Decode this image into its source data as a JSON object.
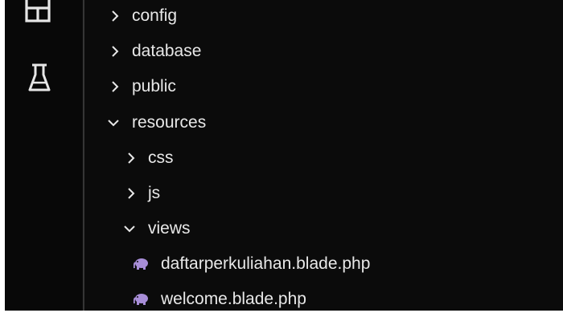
{
  "activity_bar": {
    "icons": [
      "extensions-icon",
      "testing-flask-icon"
    ]
  },
  "explorer": {
    "items": [
      {
        "label": "config",
        "type": "folder",
        "expanded": false,
        "depth": 0
      },
      {
        "label": "database",
        "type": "folder",
        "expanded": false,
        "depth": 0
      },
      {
        "label": "public",
        "type": "folder",
        "expanded": false,
        "depth": 0
      },
      {
        "label": "resources",
        "type": "folder",
        "expanded": true,
        "depth": 0
      },
      {
        "label": "css",
        "type": "folder",
        "expanded": false,
        "depth": 1
      },
      {
        "label": "js",
        "type": "folder",
        "expanded": false,
        "depth": 1
      },
      {
        "label": "views",
        "type": "folder",
        "expanded": true,
        "depth": 1
      },
      {
        "label": "daftarperkuliahan.blade.php",
        "type": "file",
        "depth": 2,
        "icon": "php-elephant-icon"
      },
      {
        "label": "welcome.blade.php",
        "type": "file",
        "depth": 2,
        "icon": "php-elephant-icon"
      }
    ]
  },
  "colors": {
    "background": "#0b0b0b",
    "text": "#e8e8e8",
    "divider": "#353535",
    "php_icon": "#a88ed8"
  }
}
